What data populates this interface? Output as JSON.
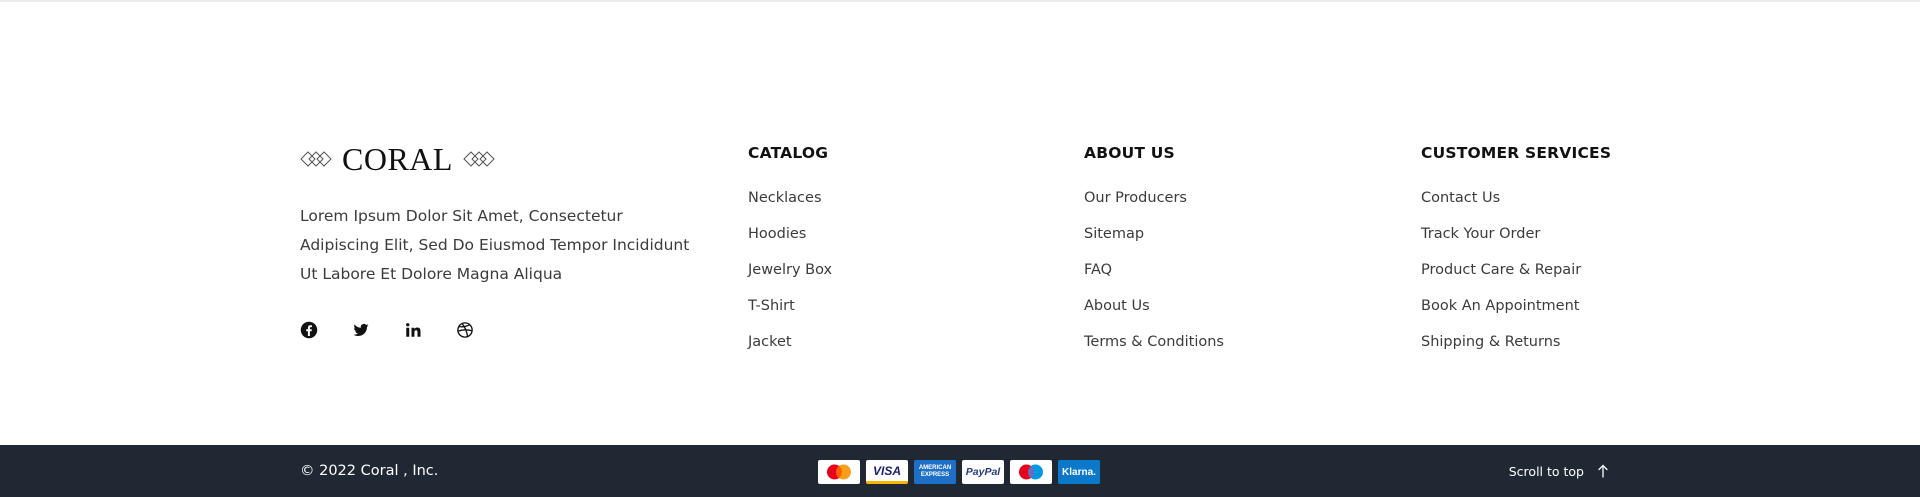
{
  "brand": {
    "logo_text": "CORAL",
    "description": "Lorem Ipsum Dolor Sit Amet, Consectetur Adipiscing Elit, Sed Do Eiusmod Tempor Incididunt Ut Labore Et Dolore Magna Aliqua",
    "socials": [
      "facebook-icon",
      "twitter-icon",
      "linkedin-icon",
      "dribbble-icon"
    ]
  },
  "columns": [
    {
      "title": "CATALOG",
      "items": [
        "Necklaces",
        "Hoodies",
        "Jewelry Box",
        "T-Shirt",
        "Jacket"
      ]
    },
    {
      "title": "ABOUT US",
      "items": [
        "Our Producers",
        "Sitemap",
        "FAQ",
        "About Us",
        "Terms & Conditions"
      ]
    },
    {
      "title": "CUSTOMER SERVICES",
      "items": [
        "Contact Us",
        "Track Your Order",
        "Product Care & Repair",
        "Book An Appointment",
        "Shipping & Returns"
      ]
    }
  ],
  "bottom_bar": {
    "copyright": "© 2022 Coral , Inc.",
    "payments": {
      "visa": "VISA",
      "amex_line1": "AMERICAN",
      "amex_line2": "EXPRESS",
      "paypal": "PayPal",
      "klarna": "Klarna."
    },
    "scroll_top_label": "Scroll to top"
  },
  "colors": {
    "bottom_bar_bg": "#1f2833",
    "heading": "#111111",
    "link": "#3b3b3b"
  }
}
